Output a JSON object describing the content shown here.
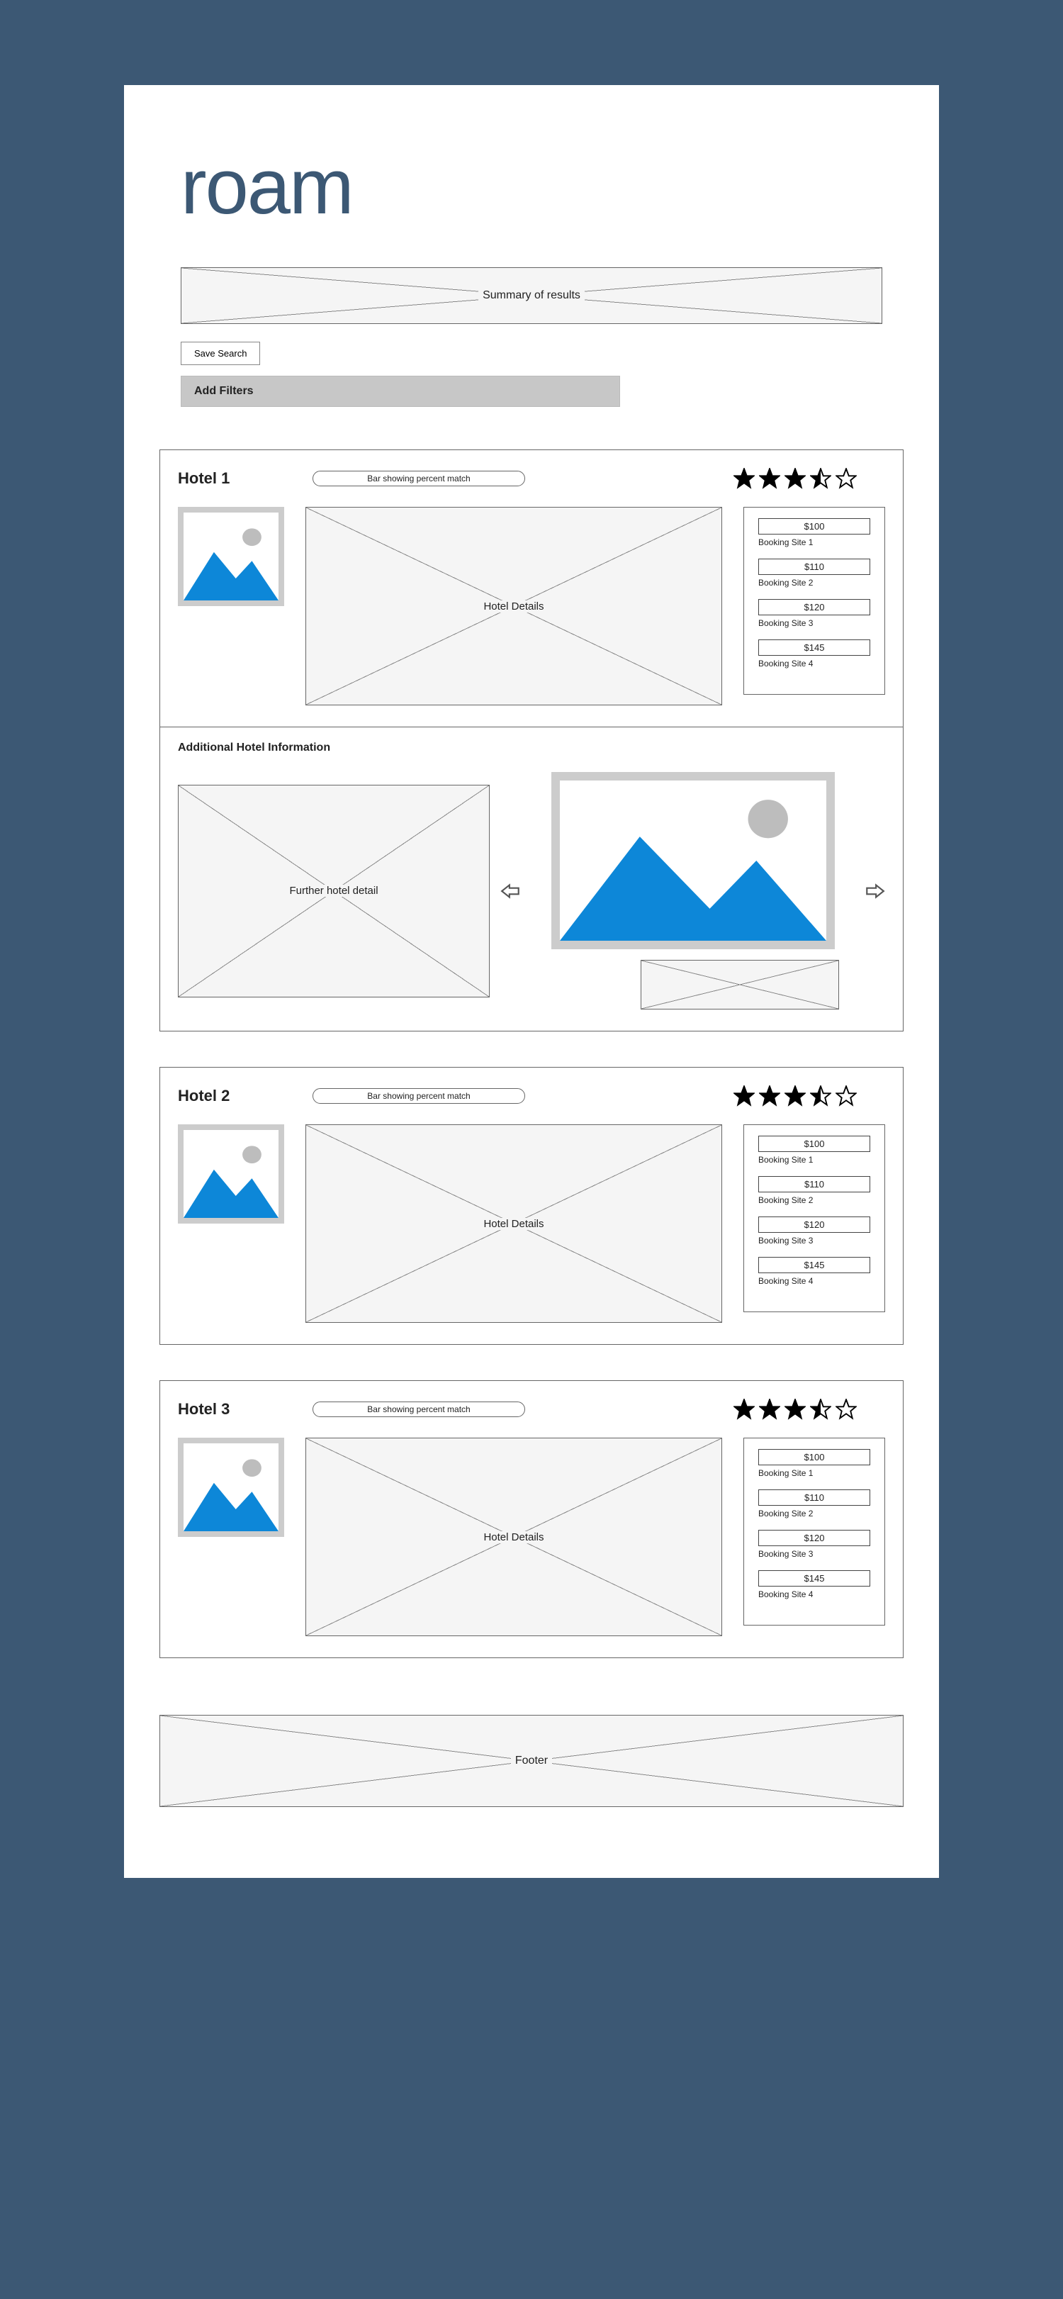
{
  "brand": "roam",
  "summary_label": "Summary of results",
  "save_search_label": "Save Search",
  "add_filters_label": "Add Filters",
  "match_bar_label": "Bar showing percent match",
  "details_label": "Hotel Details",
  "expanded": {
    "title": "Additional Hotel Information",
    "further_label": "Further hotel detail"
  },
  "footer_label": "Footer",
  "hotels": [
    {
      "name": "Hotel 1",
      "rating": 3.5,
      "prices": [
        {
          "price": "$100",
          "site": "Booking Site 1"
        },
        {
          "price": "$110",
          "site": "Booking Site 2"
        },
        {
          "price": "$120",
          "site": "Booking Site 3"
        },
        {
          "price": "$145",
          "site": "Booking Site 4"
        }
      ]
    },
    {
      "name": "Hotel 2",
      "rating": 3.5,
      "prices": [
        {
          "price": "$100",
          "site": "Booking Site 1"
        },
        {
          "price": "$110",
          "site": "Booking Site 2"
        },
        {
          "price": "$120",
          "site": "Booking Site 3"
        },
        {
          "price": "$145",
          "site": "Booking Site 4"
        }
      ]
    },
    {
      "name": "Hotel 3",
      "rating": 3.5,
      "prices": [
        {
          "price": "$100",
          "site": "Booking Site 1"
        },
        {
          "price": "$110",
          "site": "Booking Site 2"
        },
        {
          "price": "$120",
          "site": "Booking Site 3"
        },
        {
          "price": "$145",
          "site": "Booking Site 4"
        }
      ]
    }
  ]
}
